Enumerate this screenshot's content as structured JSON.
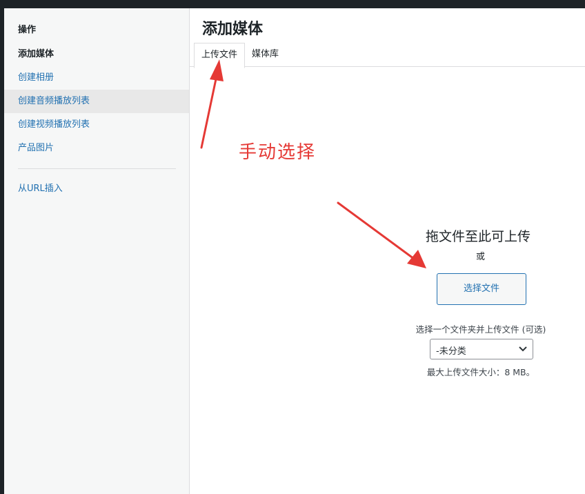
{
  "menu": {
    "heading": "操作",
    "items": [
      {
        "label": "添加媒体"
      },
      {
        "label": "创建相册"
      },
      {
        "label": "创建音频播放列表"
      },
      {
        "label": "创建视频播放列表"
      },
      {
        "label": "产品图片"
      }
    ],
    "url_insert": "从URL插入"
  },
  "frame": {
    "title": "添加媒体",
    "tabs": [
      {
        "label": "上传文件"
      },
      {
        "label": "媒体库"
      }
    ]
  },
  "uploader": {
    "drop_title": "拖文件至此可上传",
    "or": "或",
    "select_button": "选择文件",
    "folder_label": "选择一个文件夹并上传文件 (可选)",
    "folder_selected": "-未分类",
    "max_size": "最大上传文件大小：8 MB。"
  },
  "annotation": {
    "text": "手动选择",
    "color": "#e53935"
  },
  "icons": {
    "dropdown": "chevron-down-icon",
    "arrow": "red-arrow-annotation"
  }
}
